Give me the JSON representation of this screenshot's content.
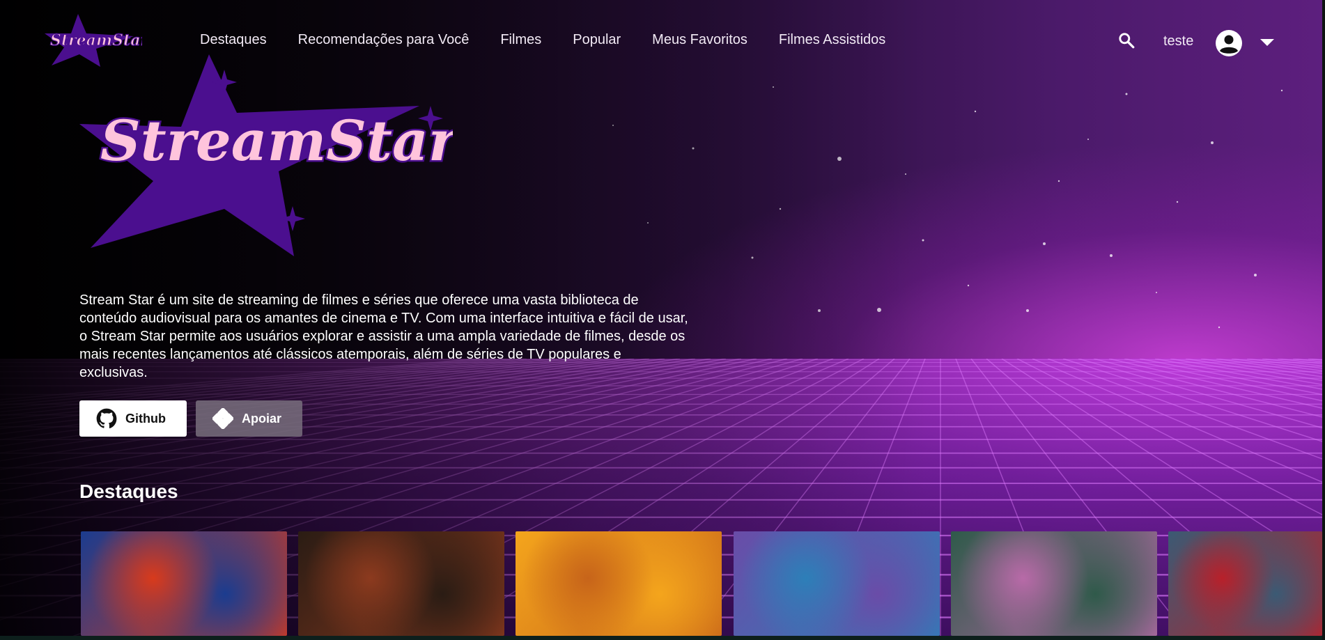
{
  "app": {
    "logo_text": "StreamStar"
  },
  "header": {
    "nav": [
      {
        "label": "Destaques"
      },
      {
        "label": "Recomendações para Você"
      },
      {
        "label": "Filmes"
      },
      {
        "label": "Popular"
      },
      {
        "label": "Meus Favoritos"
      },
      {
        "label": "Filmes Assistidos"
      }
    ],
    "search_icon": "search-icon",
    "username": "teste",
    "avatar_icon": "account-circle-icon",
    "menu_icon": "caret-down-icon"
  },
  "hero": {
    "logo_text": "StreamStar",
    "description": "Stream Star é um site de streaming de filmes e séries que oferece uma vasta biblioteca de conteúdo audiovisual para os amantes de cinema e TV. Com uma interface intuitiva e fácil de usar, o Stream Star permite aos usuários explorar e assistir a uma ampla variedade de filmes, desde os mais recentes lançamentos até clássicos atemporais, além de séries de TV populares e exclusivas.",
    "buttons": {
      "github_label": "Github",
      "github_icon": "github-icon",
      "apoiar_label": "Apoiar",
      "apoiar_icon": "pix-icon"
    }
  },
  "featured": {
    "title": "Destaques",
    "cards": [
      {
        "name": "movie-card-1",
        "palette": [
          "#1b3c8f",
          "#d83a1c"
        ]
      },
      {
        "name": "movie-card-2",
        "palette": [
          "#2a1c14",
          "#8c3a1e"
        ]
      },
      {
        "name": "movie-card-3",
        "palette": [
          "#f4a51c",
          "#c7641a"
        ]
      },
      {
        "name": "movie-card-4",
        "palette": [
          "#6a4ca8",
          "#2d7fb8"
        ]
      },
      {
        "name": "movie-card-5",
        "palette": [
          "#2f5a4a",
          "#b86aa8"
        ]
      },
      {
        "name": "movie-card-6",
        "palette": [
          "#3b5a74",
          "#b8202a"
        ]
      }
    ]
  },
  "colors": {
    "brand_purple": "#4b0f8f",
    "brand_pink": "#ffc4dc",
    "neon": "#d24cf0"
  }
}
